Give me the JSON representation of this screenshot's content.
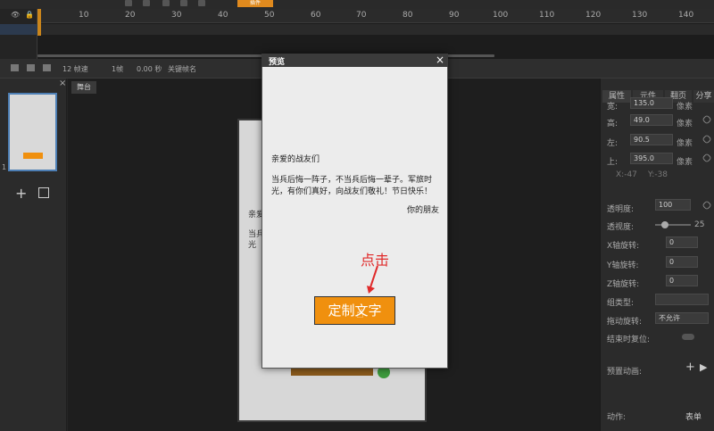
{
  "toolbar": {
    "btn": "插件"
  },
  "timeline": {
    "ticks": [
      "10",
      "20",
      "30",
      "40",
      "50",
      "60",
      "70",
      "80",
      "90",
      "100",
      "110",
      "120",
      "130",
      "140"
    ]
  },
  "status": {
    "fps": "12 帧速",
    "frame": "1帧",
    "time": "0.00 秒",
    "keyframe": "关键帧名"
  },
  "stage": {
    "tab": "舞台",
    "text1": "亲爱",
    "text2": "当兵",
    "text3": "光"
  },
  "right": {
    "tabs": [
      "属性",
      "元件",
      "翻页",
      "分享"
    ],
    "w_label": "宽:",
    "w_value": "135.0",
    "h_label": "高:",
    "h_value": "49.0",
    "l_label": "左:",
    "l_value": "90.5",
    "t_label": "上:",
    "t_value": "395.0",
    "unit": "像素",
    "x": "X:-47",
    "y": "Y:-38",
    "opacity_label": "透明度:",
    "opacity_value": "100",
    "perspective_label": "透视度:",
    "perspective_value": "25",
    "xrot": "X轴旋转:",
    "yrot": "Y轴旋转:",
    "zrot": "Z轴旋转:",
    "rot_value": "0",
    "group": "组类型:",
    "drag": "拖动旋转:",
    "drag_value": "不允许",
    "reset": "结束时复位:",
    "preset": "预置动画:",
    "action": "动作:",
    "action_value": "表单"
  },
  "modal": {
    "title": "预览",
    "close": "×",
    "greet": "亲爱的战友们",
    "body": "当兵后悔一阵子，不当兵后悔一辈子。军旅时光，有你们真好，向战友们敬礼！节日快乐！",
    "sign": "你的朋友",
    "cta": "定制文字"
  },
  "annotation": "点击",
  "colors": {
    "accent": "#f0900e",
    "selection": "#4d7fb5",
    "annotation": "#e02a2a"
  }
}
